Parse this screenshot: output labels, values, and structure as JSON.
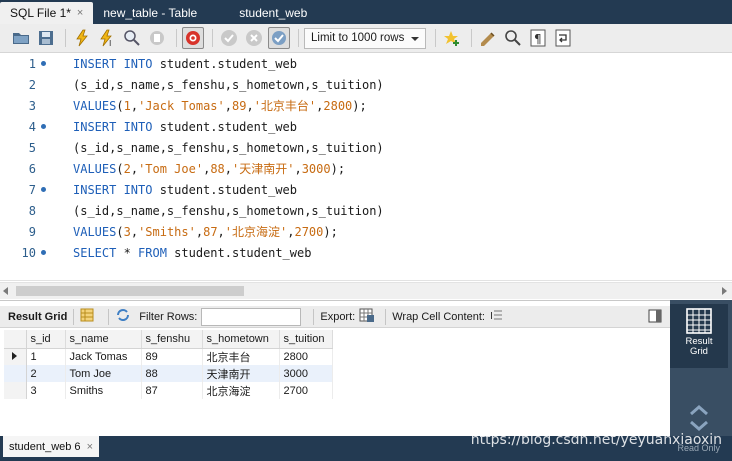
{
  "tabs": [
    {
      "label": "SQL File 1*",
      "active": true
    },
    {
      "label": "new_table - Table",
      "active": false
    },
    {
      "label": "student_web",
      "active": false
    }
  ],
  "tab_close": "×",
  "toolbar": {
    "limit_label": "Limit to 1000 rows",
    "icons": [
      "open-folder-icon",
      "save-icon",
      "execute-icon",
      "execute-current-icon",
      "explain-icon",
      "stop-icon",
      "toggle-error-icon",
      "commit-icon",
      "rollback-icon",
      "autocommit-icon",
      "add-snippet-icon",
      "beautify-icon",
      "find-icon",
      "invisible-chars-icon",
      "wrap-icon"
    ]
  },
  "editor": {
    "lines": [
      {
        "num": "1",
        "dot": true,
        "tokens": [
          {
            "t": "kw",
            "v": "INSERT INTO"
          },
          {
            "t": "plain",
            "v": " student.student_web"
          }
        ]
      },
      {
        "num": "2",
        "dot": false,
        "tokens": [
          {
            "t": "plain",
            "v": "(s_id,s_name,s_fenshu,s_hometown,s_tuition)"
          }
        ]
      },
      {
        "num": "3",
        "dot": false,
        "tokens": [
          {
            "t": "kw",
            "v": "VALUES"
          },
          {
            "t": "plain",
            "v": "("
          },
          {
            "t": "num",
            "v": "1"
          },
          {
            "t": "plain",
            "v": ","
          },
          {
            "t": "str",
            "v": "'Jack Tomas'"
          },
          {
            "t": "plain",
            "v": ","
          },
          {
            "t": "num",
            "v": "89"
          },
          {
            "t": "plain",
            "v": ","
          },
          {
            "t": "str",
            "v": "'北京丰台'"
          },
          {
            "t": "plain",
            "v": ","
          },
          {
            "t": "num",
            "v": "2800"
          },
          {
            "t": "plain",
            "v": ");"
          }
        ]
      },
      {
        "num": "4",
        "dot": true,
        "tokens": [
          {
            "t": "kw",
            "v": "INSERT INTO"
          },
          {
            "t": "plain",
            "v": " student.student_web"
          }
        ]
      },
      {
        "num": "5",
        "dot": false,
        "tokens": [
          {
            "t": "plain",
            "v": "(s_id,s_name,s_fenshu,s_hometown,s_tuition)"
          }
        ]
      },
      {
        "num": "6",
        "dot": false,
        "tokens": [
          {
            "t": "kw",
            "v": "VALUES"
          },
          {
            "t": "plain",
            "v": "("
          },
          {
            "t": "num",
            "v": "2"
          },
          {
            "t": "plain",
            "v": ","
          },
          {
            "t": "str",
            "v": "'Tom Joe'"
          },
          {
            "t": "plain",
            "v": ","
          },
          {
            "t": "num",
            "v": "88"
          },
          {
            "t": "plain",
            "v": ","
          },
          {
            "t": "str",
            "v": "'天津南开'"
          },
          {
            "t": "plain",
            "v": ","
          },
          {
            "t": "num",
            "v": "3000"
          },
          {
            "t": "plain",
            "v": ");"
          }
        ]
      },
      {
        "num": "7",
        "dot": true,
        "tokens": [
          {
            "t": "kw",
            "v": "INSERT INTO"
          },
          {
            "t": "plain",
            "v": " student.student_web"
          }
        ]
      },
      {
        "num": "8",
        "dot": false,
        "tokens": [
          {
            "t": "plain",
            "v": "(s_id,s_name,s_fenshu,s_hometown,s_tuition)"
          }
        ]
      },
      {
        "num": "9",
        "dot": false,
        "tokens": [
          {
            "t": "kw",
            "v": "VALUES"
          },
          {
            "t": "plain",
            "v": "("
          },
          {
            "t": "num",
            "v": "3"
          },
          {
            "t": "plain",
            "v": ","
          },
          {
            "t": "str",
            "v": "'Smiths'"
          },
          {
            "t": "plain",
            "v": ","
          },
          {
            "t": "num",
            "v": "87"
          },
          {
            "t": "plain",
            "v": ","
          },
          {
            "t": "str",
            "v": "'北京海淀'"
          },
          {
            "t": "plain",
            "v": ","
          },
          {
            "t": "num",
            "v": "2700"
          },
          {
            "t": "plain",
            "v": ");"
          }
        ]
      },
      {
        "num": "10",
        "dot": true,
        "tokens": [
          {
            "t": "kw",
            "v": "SELECT"
          },
          {
            "t": "plain",
            "v": " * "
          },
          {
            "t": "kw",
            "v": "FROM"
          },
          {
            "t": "plain",
            "v": " student.student_web"
          }
        ]
      }
    ]
  },
  "result_toolbar": {
    "result_grid_label": "Result Grid",
    "filter_label": "Filter Rows:",
    "export_label": "Export:",
    "wrap_label": "Wrap Cell Content:"
  },
  "grid": {
    "columns": [
      "s_id",
      "s_name",
      "s_fenshu",
      "s_hometown",
      "s_tuition"
    ],
    "rows": [
      [
        "1",
        "Jack Tomas",
        "89",
        "北京丰台",
        "2800"
      ],
      [
        "2",
        "Tom Joe",
        "88",
        "天津南开",
        "3000"
      ],
      [
        "3",
        "Smiths",
        "87",
        "北京海淀",
        "2700"
      ]
    ]
  },
  "side_panel": {
    "result_label_1": "Result",
    "result_label_2": "Grid",
    "read_only": "Read Only"
  },
  "bottom_tab": {
    "label": "student_web 6",
    "close": "×"
  },
  "watermark": "https://blog.csdn.net/yeyuanxiaoxin",
  "colors": {
    "keyword": "#1e5fb8",
    "string": "#c76b12",
    "line_number": "#2d5e8c",
    "chrome_dark": "#233a52"
  }
}
